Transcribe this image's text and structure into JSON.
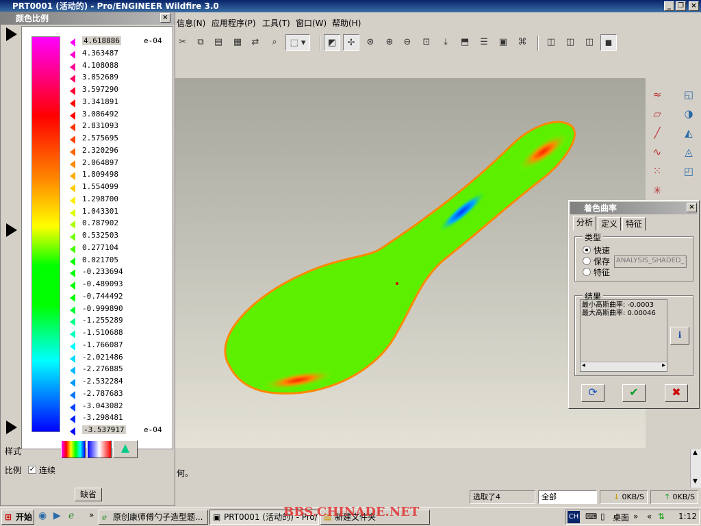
{
  "window": {
    "title": "PRT0001 (活动的) - Pro/ENGINEER Wildfire 3.0"
  },
  "menubar": {
    "items": [
      "信息(N)",
      "应用程序(P)",
      "工具(T)",
      "窗口(W)",
      "帮助(H)"
    ]
  },
  "color_scale": {
    "title": "颜色比例",
    "exponent": "e-04",
    "values": [
      "4.618886",
      "4.363487",
      "4.108088",
      "3.852689",
      "3.597290",
      "3.341891",
      "3.086492",
      "2.831093",
      "2.575695",
      "2.320296",
      "2.064897",
      "1.809498",
      "1.554099",
      "1.298700",
      "1.043301",
      "0.787902",
      "0.532503",
      "0.277104",
      "0.021705",
      "-0.233694",
      "-0.489093",
      "-0.744492",
      "-0.999890",
      "-1.255289",
      "-1.510688",
      "-1.766087",
      "-2.021486",
      "-2.276885",
      "-2.532284",
      "-2.787683",
      "-3.043082",
      "-3.298481",
      "-3.537917"
    ],
    "marker_colors": [
      "#ff00ff",
      "#ff00cc",
      "#ff0099",
      "#ff0066",
      "#ff0033",
      "#ff0000",
      "#ff0000",
      "#ff3300",
      "#ff4400",
      "#ff6600",
      "#ff8800",
      "#ffaa00",
      "#ffcc00",
      "#ffee00",
      "#ddff00",
      "#aaff00",
      "#77ff00",
      "#44ff00",
      "#00ff00",
      "#00ff00",
      "#00ff00",
      "#00ff00",
      "#00ff33",
      "#00ff88",
      "#00ffbb",
      "#00ffff",
      "#00ddff",
      "#00bbff",
      "#0099ff",
      "#0077ff",
      "#0044ff",
      "#0022ff",
      "#0000ff"
    ],
    "style_label": "样式",
    "scale_label": "比例",
    "continuous_label": "连续",
    "default_button": "缺省"
  },
  "dialog": {
    "title": "着色曲率",
    "tabs": [
      "分析",
      "定义",
      "特征"
    ],
    "type_group": "类型",
    "type_options": [
      "快速",
      "保存",
      "特征"
    ],
    "name_field": "ANALYSIS_SHADED_1",
    "results_group": "结果",
    "results": [
      "最小高斯曲率: -0.0003",
      "最大高斯曲率: 0.00046"
    ]
  },
  "message_area": {
    "text": "何。"
  },
  "statusbar": {
    "selected": "选取了4",
    "filter": "全部",
    "down_rate": "0KB/S",
    "up_rate": "0KB/S"
  },
  "taskbar": {
    "start": "开始",
    "tasks": [
      "原创康师傅勺子造型题...",
      "PRT0001 (活动的) - Pro/...",
      "新建文件夹"
    ],
    "watermark": "BBS.CHINADE.NET",
    "lang": "CH",
    "desktop": "桌面",
    "clock": "1:12"
  }
}
